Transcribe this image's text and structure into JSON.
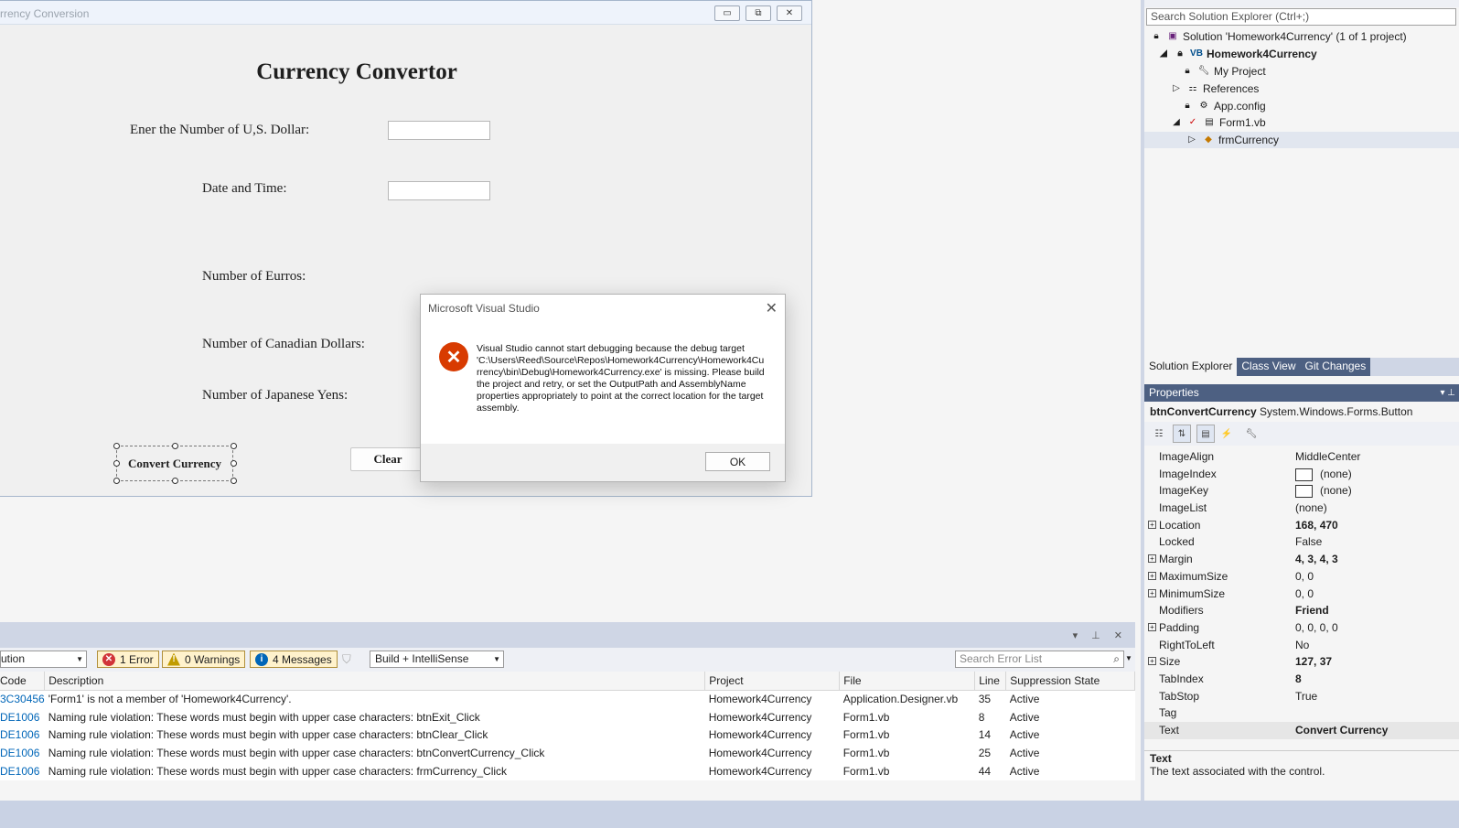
{
  "form_window": {
    "title": "rrency Conversion",
    "title_text": "Currency Convertor",
    "labels": {
      "usd": "Ener the Number of U,S. Dollar:",
      "datetime": "Date and Time:",
      "euros": "Number of Eurros:",
      "cad": "Number of Canadian Dollars:",
      "yen": "Number of Japanese Yens:"
    },
    "buttons": {
      "convert": "Convert Currency",
      "clear": "Clear"
    },
    "controls": {
      "minimize": "▭",
      "restore": "⧉",
      "close": "✕"
    }
  },
  "dialog": {
    "title": "Microsoft Visual Studio",
    "icon": "error-icon",
    "message": "Visual Studio cannot start debugging because the debug target 'C:\\Users\\Reed\\Source\\Repos\\Homework4Currency\\Homework4Currency\\bin\\Debug\\Homework4Currency.exe' is missing. Please build the project and retry, or set the OutputPath and AssemblyName properties appropriately to point at the correct location for the target assembly.",
    "ok_label": "OK"
  },
  "error_list": {
    "scope": "ution",
    "errors_label": "1 Error",
    "warnings_label": "0 Warnings",
    "messages_label": "4 Messages",
    "build_filter": "Build + IntelliSense",
    "search_placeholder": "Search Error List",
    "columns": [
      "Code",
      "Description",
      "Project",
      "File",
      "Line",
      "Suppression State"
    ],
    "rows": [
      {
        "code": "3C30456",
        "description": "'Form1' is not a member of 'Homework4Currency'.",
        "project": "Homework4Currency",
        "file": "Application.Designer.vb",
        "line": "35",
        "state": "Active"
      },
      {
        "code": "DE1006",
        "description": "Naming rule violation: These words must begin with upper case characters: btnExit_Click",
        "project": "Homework4Currency",
        "file": "Form1.vb",
        "line": "8",
        "state": "Active"
      },
      {
        "code": "DE1006",
        "description": "Naming rule violation: These words must begin with upper case characters: btnClear_Click",
        "project": "Homework4Currency",
        "file": "Form1.vb",
        "line": "14",
        "state": "Active"
      },
      {
        "code": "DE1006",
        "description": "Naming rule violation: These words must begin with upper case characters: btnConvertCurrency_Click",
        "project": "Homework4Currency",
        "file": "Form1.vb",
        "line": "25",
        "state": "Active"
      },
      {
        "code": "DE1006",
        "description": "Naming rule violation: These words must begin with upper case characters: frmCurrency_Click",
        "project": "Homework4Currency",
        "file": "Form1.vb",
        "line": "44",
        "state": "Active"
      }
    ]
  },
  "solution_explorer": {
    "search_placeholder": "Search Solution Explorer (Ctrl+;)",
    "items": [
      {
        "label": "Solution 'Homework4Currency' (1 of 1 project)"
      },
      {
        "label": "Homework4Currency"
      },
      {
        "label": "My Project"
      },
      {
        "label": "References"
      },
      {
        "label": "App.config"
      },
      {
        "label": "Form1.vb"
      },
      {
        "label": "frmCurrency"
      }
    ],
    "tabs": [
      "Solution Explorer",
      "Class View",
      "Git Changes"
    ]
  },
  "properties": {
    "header": "Properties",
    "object_name": "btnConvertCurrency",
    "object_type": "System.Windows.Forms.Button",
    "rows": [
      {
        "name": "ImageAlign",
        "value": "MiddleCenter"
      },
      {
        "name": "ImageIndex",
        "value": "(none)"
      },
      {
        "name": "ImageKey",
        "value": "(none)"
      },
      {
        "name": "ImageList",
        "value": "(none)"
      },
      {
        "name": "Location",
        "value": "168, 470"
      },
      {
        "name": "Locked",
        "value": "False"
      },
      {
        "name": "Margin",
        "value": "4, 3, 4, 3"
      },
      {
        "name": "MaximumSize",
        "value": "0, 0"
      },
      {
        "name": "MinimumSize",
        "value": "0, 0"
      },
      {
        "name": "Modifiers",
        "value": "Friend"
      },
      {
        "name": "Padding",
        "value": "0, 0, 0, 0"
      },
      {
        "name": "RightToLeft",
        "value": "No"
      },
      {
        "name": "Size",
        "value": "127, 37"
      },
      {
        "name": "TabIndex",
        "value": "8"
      },
      {
        "name": "TabStop",
        "value": "True"
      },
      {
        "name": "Tag",
        "value": ""
      },
      {
        "name": "Text",
        "value": "Convert Currency"
      }
    ],
    "description_name": "Text",
    "description_text": "The text associated with the control."
  },
  "colors": {
    "accent": "#4d6082",
    "error": "#d83b01",
    "warning_pill": "#fff2cc",
    "link_code": "#0066b8"
  }
}
